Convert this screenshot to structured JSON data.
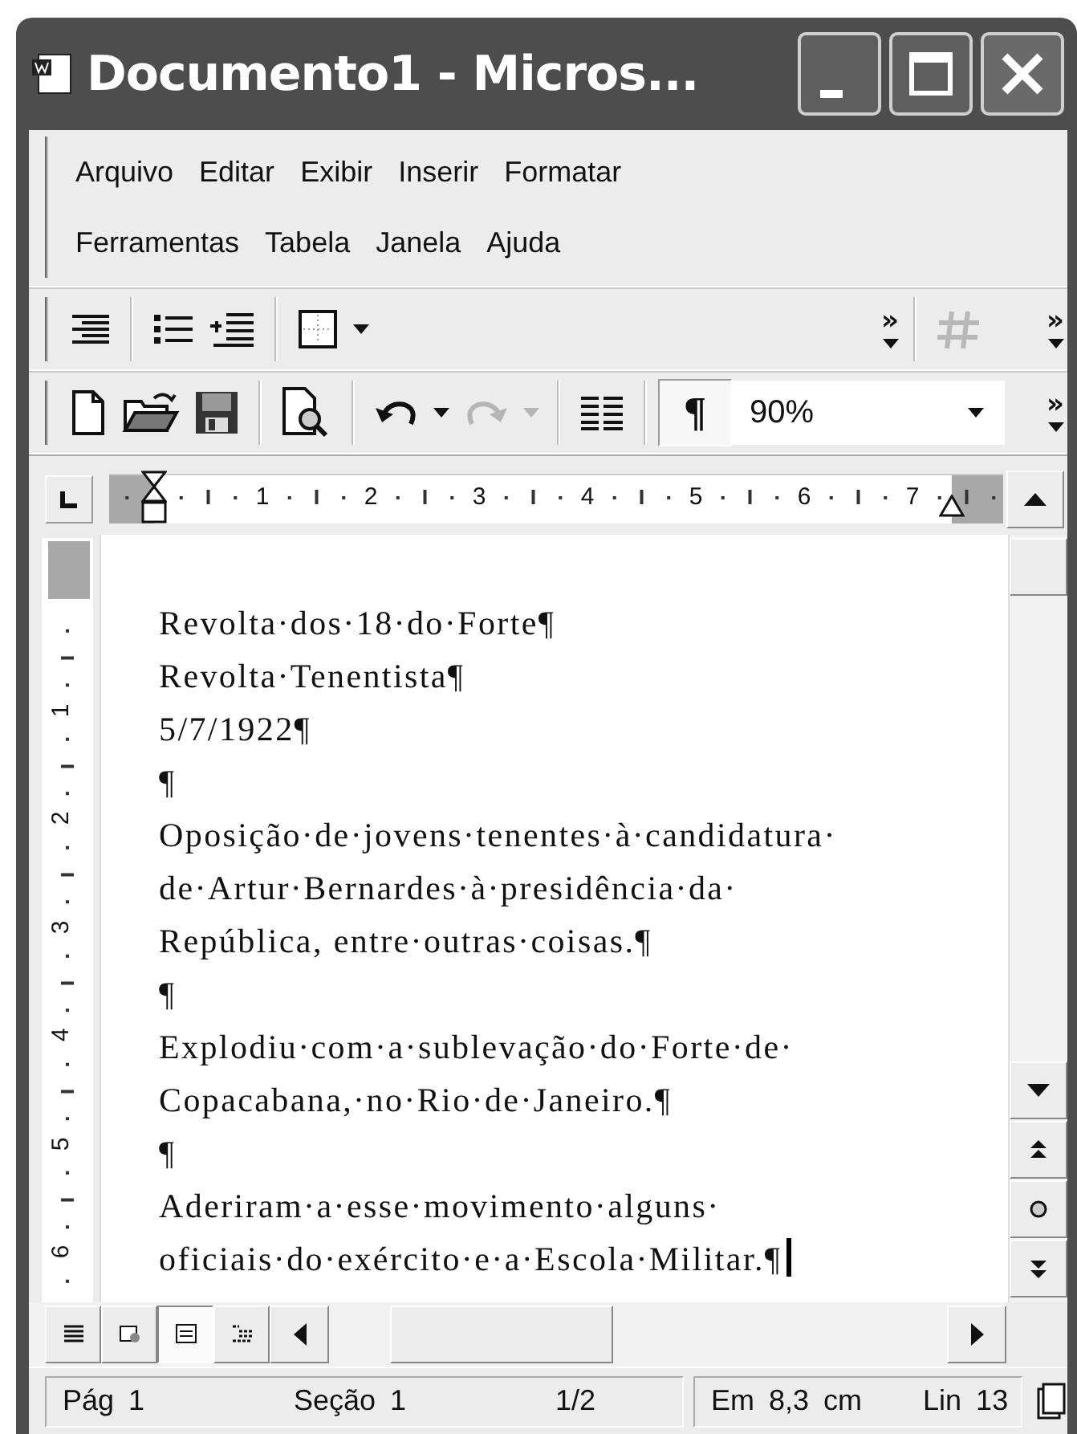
{
  "window": {
    "title": "Documento1 - Micros..."
  },
  "menu_rows": [
    {
      "items": [
        {
          "label": "Arquivo"
        },
        {
          "label": "Editar"
        },
        {
          "label": "Exibir"
        },
        {
          "label": "Inserir"
        },
        {
          "label": "Formatar"
        }
      ]
    },
    {
      "items": [
        {
          "label": "Ferramentas"
        },
        {
          "label": "Tabela"
        },
        {
          "label": "Janela"
        },
        {
          "label": "Ajuda"
        }
      ]
    }
  ],
  "formatting_toolbar": {
    "overflow": "»",
    "tables_overflow": "»",
    "draw_table": {
      "disabled": true
    }
  },
  "standard_toolbar": {
    "undo": {
      "disabled": false
    },
    "redo": {
      "disabled": true
    },
    "show_marks": {
      "label": "¶",
      "selected": true
    },
    "zoom": {
      "value": "90%"
    },
    "overflow": "»"
  },
  "horizontal_ruler": {
    "numbers": [
      "1",
      "2",
      "3",
      "4",
      "5",
      "6",
      "7"
    ]
  },
  "vertical_ruler": {
    "numbers": [
      "1",
      "2",
      "3",
      "4",
      "5",
      "6"
    ]
  },
  "document": {
    "lines": [
      "Revolta·dos·18·do·Forte¶",
      "Revolta·Tenentista¶",
      "5/7/1922¶",
      "¶",
      "Oposição·de·jovens·tenentes·à·candidatura·",
      "de·Artur·Bernardes·à·presidência·da·",
      "República, entre·outras·coisas.¶",
      "¶",
      "Explodiu·com·a·sublevação·do·Forte·de·",
      "Copacabana,·no·Rio·de·Janeiro.¶",
      "¶",
      "Aderiram·a·esse·movimento·alguns·",
      "oficiais·do·exército·e·a·Escola·Militar.¶"
    ]
  },
  "view_buttons": [
    {
      "kind": "normal",
      "selected": false
    },
    {
      "kind": "web",
      "selected": false
    },
    {
      "kind": "print",
      "selected": true
    },
    {
      "kind": "outline",
      "selected": false
    }
  ],
  "status_bar": {
    "groups": [
      {
        "items": [
          "Pág 1",
          "Seção 1",
          "1/2"
        ]
      },
      {
        "items": [
          "Em 8,3 cm",
          "Lin 13"
        ]
      }
    ]
  }
}
